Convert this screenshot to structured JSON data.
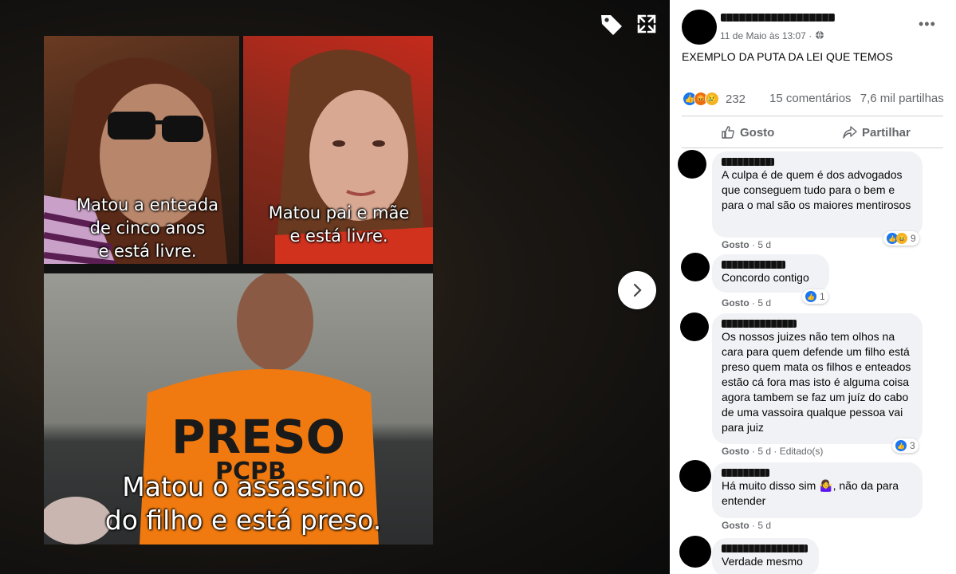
{
  "meme": {
    "caption_left": "Matou a enteada\nde cinco anos\ne está livre.",
    "caption_right": "Matou pai e mãe\ne está livre.",
    "caption_bottom": "Matou o assassino\ndo filho e está preso.",
    "shirt_text": "PRESO",
    "shirt_subtext": "PCPB"
  },
  "post": {
    "timestamp": "11 de Maio às 13:07 ·",
    "text": "EXEMPLO DA PUTA DA LEI QUE TEMOS",
    "reaction_count": "232",
    "comments_count": "15 comentários",
    "shares_count": "7,6 mil partilhas",
    "like_label": "Gosto",
    "share_label": "Partilhar",
    "more_label": "•••"
  },
  "comments": [
    {
      "text": "A culpa é de quem é dos advogados que conseguem tudo para o bem e para o mal são os maiores mentirosos",
      "like": "Gosto",
      "time": "5 d",
      "edited": "",
      "reactions": "9"
    },
    {
      "text": "Concordo contigo",
      "like": "Gosto",
      "time": "5 d",
      "edited": "",
      "reactions": "1"
    },
    {
      "text": "Os nossos juizes não tem olhos na cara para quem defende um filho está preso quem mata os filhos e enteados estão cá fora mas isto é alguma coisa agora tambem se faz um juíz do cabo de uma vassoira qualque pessoa vai para juiz",
      "like": "Gosto",
      "time": "5 d",
      "edited": "Editado(s)",
      "reactions": "3"
    },
    {
      "text": "Há muito disso sim 🤷‍♀️, não da para entender",
      "like": "Gosto",
      "time": "5 d",
      "edited": "",
      "reactions": ""
    },
    {
      "text": "Verdade mesmo",
      "like": "",
      "time": "",
      "edited": "",
      "reactions": ""
    }
  ],
  "colors": {
    "like_blue": "#1877f2",
    "angry": "#e9710f",
    "sad": "#f7b125",
    "haha": "#f7b125",
    "bubble": "#f0f2f5",
    "meta": "#65676b"
  },
  "icons": [
    "tag-icon",
    "expand-icon",
    "chevron-right-icon",
    "globe-icon",
    "like-icon",
    "share-icon"
  ]
}
